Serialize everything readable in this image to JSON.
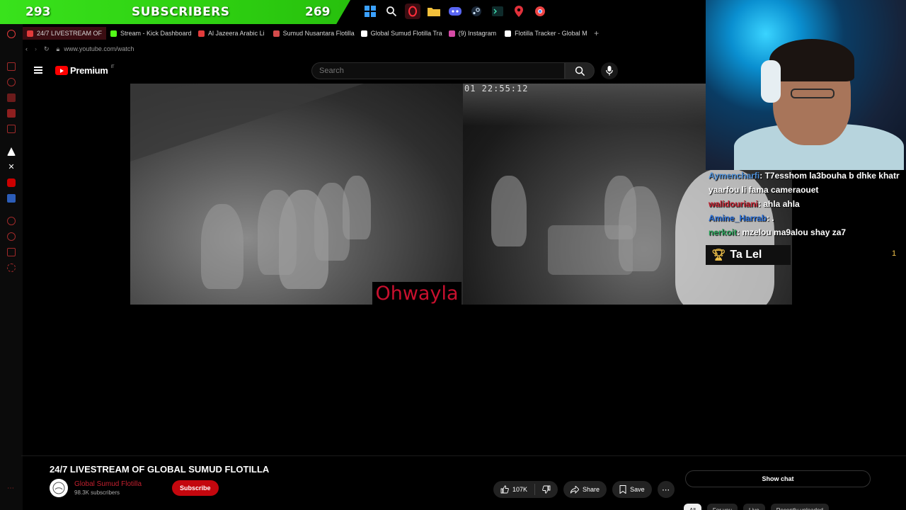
{
  "overlay": {
    "sub_current": "293",
    "sub_label": "SUBSCRIBERS",
    "sub_goal": "269"
  },
  "taskbar": {
    "icons": [
      "windows-icon",
      "search-icon",
      "opera-icon",
      "folder-icon",
      "discord-icon",
      "steam-icon",
      "terminal-icon",
      "maps-icon",
      "chrome-icon"
    ]
  },
  "browser": {
    "tabs": [
      {
        "label": "24/7 LIVESTREAM OF",
        "color": "#e23b3b",
        "active": true
      },
      {
        "label": "Stream - Kick Dashboard",
        "color": "#53fc18",
        "active": false
      },
      {
        "label": "Al Jazeera Arabic Li",
        "color": "#e23b3b",
        "active": false
      },
      {
        "label": "Sumud Nusantara Flotilla",
        "color": "#d34b4b",
        "active": false
      },
      {
        "label": "Global Sumud Flotilla Tra",
        "color": "#ffffff",
        "active": false
      },
      {
        "label": "(9) Instagram",
        "color": "#d64ba6",
        "active": false
      },
      {
        "label": "Flotilla Tracker - Global M",
        "color": "#ffffff",
        "active": false
      }
    ],
    "new_tab": "+",
    "url": "www.youtube.com/watch"
  },
  "youtube": {
    "logo_text": "Premium",
    "logo_sup": "IT",
    "search_placeholder": "Search"
  },
  "video": {
    "timestamp": "01 22:55:12",
    "watermark": "Ohwayla"
  },
  "chat": [
    {
      "user": "Aymencharfi",
      "msg": ": T7esshom la3bouha b dhke khatr yaarfou li fama cameraouet",
      "cls": "u1"
    },
    {
      "user": "walidouriani",
      "msg": ": ahla ahla",
      "cls": "u2"
    },
    {
      "user": "Amine_Harrab",
      "msg": ": .",
      "cls": "u3"
    },
    {
      "user": "nerkoit",
      "msg": ": mzelou ma9alou shay za7",
      "cls": "u4"
    }
  ],
  "top_chatter": {
    "name": "Ta Lel",
    "rank": "1"
  },
  "watch": {
    "title": "24/7 LIVESTREAM OF GLOBAL SUMUD FLOTILLA",
    "channel_name": "Global Sumud Flotilla",
    "channel_subs": "98.3K subscribers",
    "subscribe": "Subscribe",
    "likes": "107K",
    "share": "Share",
    "save": "Save",
    "show_chat": "Show chat",
    "chips": [
      "All",
      "For you",
      "Live",
      "Recently uploaded"
    ]
  }
}
